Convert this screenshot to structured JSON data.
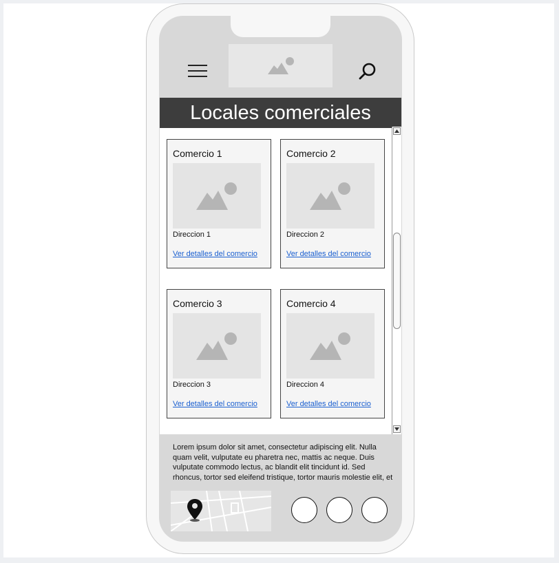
{
  "page_title": "Locales comerciales",
  "header": {
    "menu_icon": "hamburger-menu-icon",
    "logo_icon": "image-placeholder-icon",
    "search_icon": "search-icon"
  },
  "stores": [
    {
      "name": "Comercio 1",
      "address": "Direccion 1",
      "link": "Ver detalles del comercio"
    },
    {
      "name": "Comercio 2",
      "address": "Direccion 2",
      "link": "Ver detalles del comercio"
    },
    {
      "name": "Comercio 3",
      "address": "Direccion 3",
      "link": "Ver detalles del comercio"
    },
    {
      "name": "Comercio 4",
      "address": "Direccion 4",
      "link": "Ver detalles del comercio"
    }
  ],
  "footer": {
    "text": "Lorem ipsum dolor sit amet, consectetur adipiscing elit. Nulla quam velit, vulputate eu pharetra nec, mattis ac neque. Duis vulputate commodo lectus, ac blandit elit tincidunt id. Sed rhoncus, tortor sed eleifend tristique, tortor mauris molestie elit, et lacinia ipsum quam nec dui.",
    "map_icon": "map-pin-icon",
    "social_count": 3
  },
  "colors": {
    "title_bar": "#3d3d3d",
    "link": "#1a5fd0",
    "placeholder": "#e4e4e4"
  }
}
